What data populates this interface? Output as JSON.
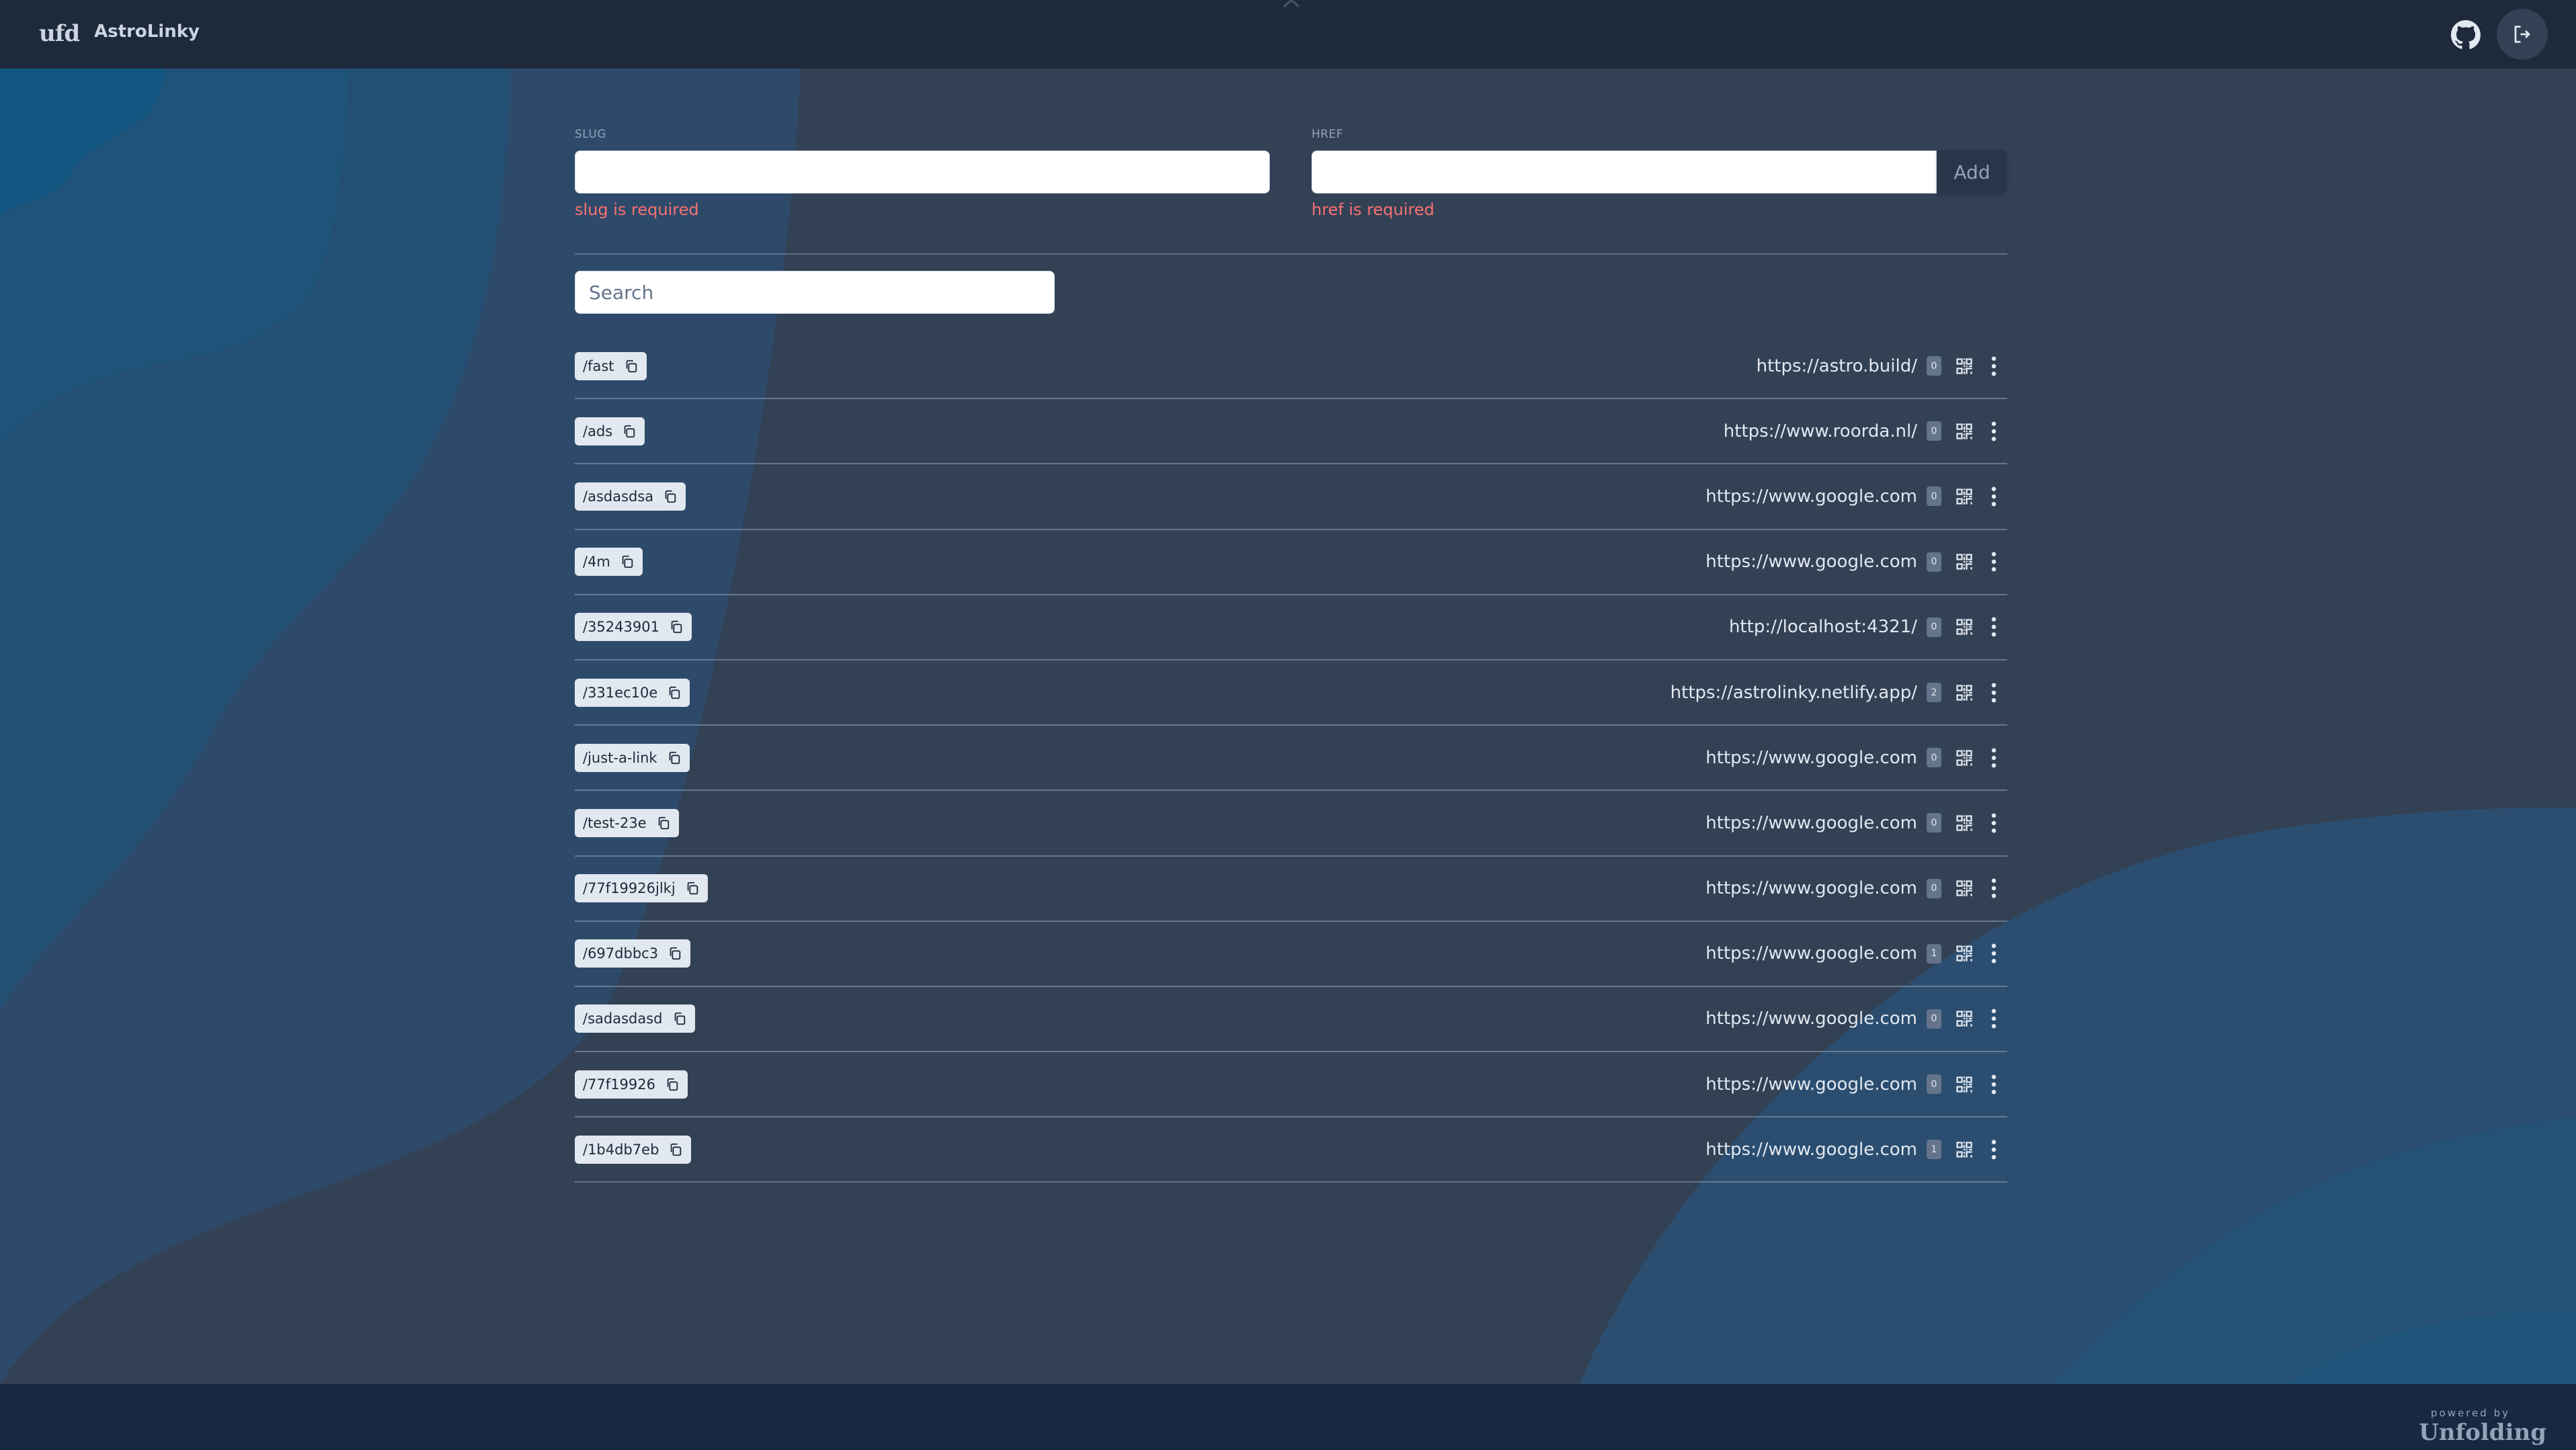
{
  "header": {
    "logo_text": "ufd",
    "app_title": "AstroLinky",
    "github_icon": "github-icon",
    "logout_icon": "logout-icon"
  },
  "form": {
    "slug_label": "SLUG",
    "slug_value": "",
    "slug_error": "slug is required",
    "href_label": "HREF",
    "href_value": "",
    "href_error": "href is required",
    "add_label": "Add"
  },
  "search": {
    "placeholder": "Search",
    "value": ""
  },
  "links": [
    {
      "slug": "/fast",
      "href": "https://astro.build/",
      "count": "0"
    },
    {
      "slug": "/ads",
      "href": "https://www.roorda.nl/",
      "count": "0"
    },
    {
      "slug": "/asdasdsa",
      "href": "https://www.google.com",
      "count": "0"
    },
    {
      "slug": "/4m",
      "href": "https://www.google.com",
      "count": "0"
    },
    {
      "slug": "/35243901",
      "href": "http://localhost:4321/",
      "count": "0"
    },
    {
      "slug": "/331ec10e",
      "href": "https://astrolinky.netlify.app/",
      "count": "2"
    },
    {
      "slug": "/just-a-link",
      "href": "https://www.google.com",
      "count": "0"
    },
    {
      "slug": "/test-23e",
      "href": "https://www.google.com",
      "count": "0"
    },
    {
      "slug": "/77f19926jlkj",
      "href": "https://www.google.com",
      "count": "0"
    },
    {
      "slug": "/697dbbc3",
      "href": "https://www.google.com",
      "count": "1"
    },
    {
      "slug": "/sadasdasd",
      "href": "https://www.google.com",
      "count": "0"
    },
    {
      "slug": "/77f19926",
      "href": "https://www.google.com",
      "count": "0"
    },
    {
      "slug": "/1b4db7eb",
      "href": "https://www.google.com",
      "count": "1"
    }
  ],
  "footer": {
    "powered_by": "powered by",
    "brand": "Unfolding"
  },
  "colors": {
    "header_bg": "#1e293b",
    "footer_bg": "#172842",
    "error": "#f87171",
    "badge_bg": "#e2e8f0",
    "count_bg": "#64748b"
  }
}
